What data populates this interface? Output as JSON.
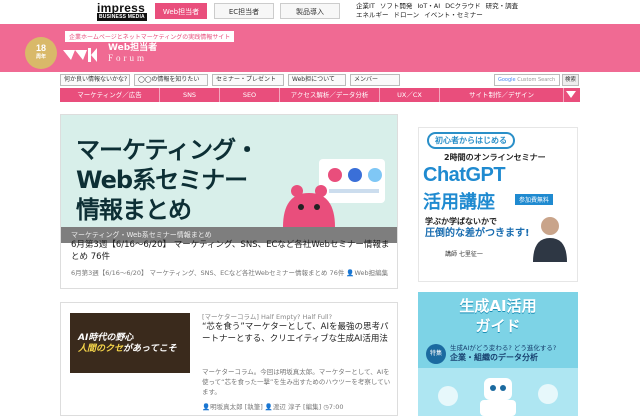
{
  "brand": {
    "name": "impress",
    "sub": "BUSINESS MEDIA"
  },
  "site_tabs": [
    {
      "label": "Web担当者",
      "active": true
    },
    {
      "label": "EC担当者",
      "active": false
    },
    {
      "label": "製品導入",
      "active": false
    }
  ],
  "categories": {
    "row1": [
      "企業IT",
      "ソフト開発",
      "IoT・AI",
      "DCクラウド",
      "研究・調査"
    ],
    "row2": [
      "エネルギー",
      "ドローン",
      "イベント・セミナー"
    ]
  },
  "header": {
    "badge_number": "18",
    "badge_unit": "周年",
    "tagline": "企業ホームページとネットマーケティングの実践情報サイト",
    "logo_line1": "Web担当者",
    "logo_line2": "Forum",
    "logo_small": "web-tan forum"
  },
  "subnav": [
    {
      "label": "何か良い情報ないかな?"
    },
    {
      "label": "◯◯の情報を知りたい"
    },
    {
      "label": "セミナー・プレゼント"
    },
    {
      "label": "Web担について"
    },
    {
      "label": "メンバー"
    }
  ],
  "search": {
    "brand": "Google",
    "placeholder": "Custom Search",
    "button": "検索"
  },
  "menu": [
    "マーケティング／広告",
    "SNS",
    "SEO",
    "アクセス解析／データ分析",
    "UX／CX",
    "サイト制作／デザイン"
  ],
  "colors": {
    "brand": "#f06a93",
    "menu": "#e94e7c",
    "ad_blue": "#1f8ad0"
  },
  "article1": {
    "hero_title_line1": "マーケティング・",
    "hero_title_line2": "Web系セミナー",
    "hero_title_line3": "情報まとめ",
    "category": "マーケティング・Web系セミナー情報まとめ",
    "title": "6月第3週【6/16〜6/20】 マーケティング、SNS、ECなど各社Webセミナー情報まとめ 76件",
    "meta_text": "6月第3週【6/16〜6/20】 マーケティング、SNS、ECなど各社Webセミナー情報まとめ 76件",
    "author": "Web担編集"
  },
  "article2": {
    "thumb_text1": "AI時代の野心",
    "thumb_text2": "人間のクセ",
    "thumb_text3": "があってこそ",
    "category": "[マーケターコラム] Half Empty? Half Full?",
    "title": "“芯を食う”マーケターとして、AIを最強の思考パートナーとする、クリエイティブな生成AI活用法",
    "excerpt": "マーケターコラム。今回は明坂真太郎。マーケターとして、AIを使って“芯を食った一撃”を生み出すためのハウツーを考察しています。",
    "author1": "明坂真太郎 [執筆]",
    "author2": "渡辺 淳子 [編集]",
    "time": "7:00"
  },
  "ad1": {
    "pill": "初心者からはじめる",
    "sub": "2時間のオンラインセミナー",
    "big": "ChatGPT",
    "big2": "活用講座",
    "free": "参加費無料",
    "q1": "学ぶか学ばないかで",
    "q2": "圧倒的な差がつきます!",
    "speaker": "講師 七里征一"
  },
  "ad2": {
    "heading1": "生成AI活用",
    "heading2": "ガイド",
    "tag": "特集",
    "line1": "生成AIがどう変わる? どう進化する?",
    "line2": "企業・組織のデータ分析"
  }
}
